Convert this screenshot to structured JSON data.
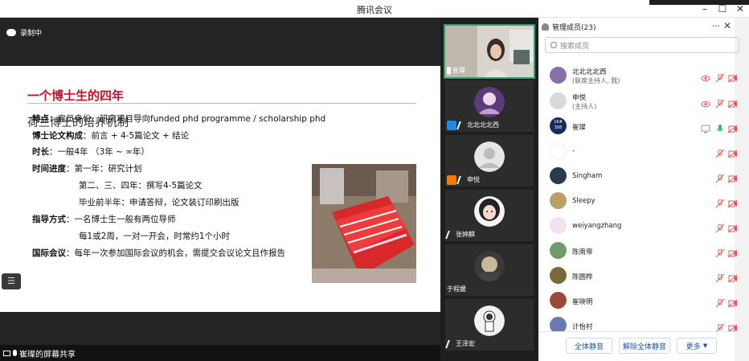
{
  "window": {
    "title": "腾讯会议"
  },
  "share": {
    "recording": "录制中",
    "footer": "崔璨的屏幕共享",
    "slide": {
      "title": "一个博士生的四年",
      "subtitle": "荷兰博士的培养机制",
      "lines": [
        {
          "label": "特点",
          "sep": "：",
          "text": "雇员身份、研究项目导向funded phd programme / scholarship phd"
        },
        {
          "label": "博士论文构成",
          "sep": "：",
          "text": "前言 + 4-5篇论文 + 结论"
        },
        {
          "label": "时长",
          "sep": "：",
          "text": "一般4年 （3年 ~ ∞年）"
        },
        {
          "label": "时间进度",
          "sep": "：",
          "text": "第一年：研究计划"
        },
        {
          "label": "",
          "sep": "",
          "text": "第二、三、四年：撰写4-5篇论文"
        },
        {
          "label": "",
          "sep": "",
          "text": "毕业前半年：申请答辩，论文装订印刷出版"
        },
        {
          "label": "指导方式",
          "sep": "：",
          "text": "一名博士生一般有两位导师"
        },
        {
          "label": "",
          "sep": "",
          "text": "每1或2周，一对一开会，时常约1个小时"
        },
        {
          "label": "国际会议",
          "sep": "：",
          "text": "每年一次参加国际会议的机会，需提交会议论文且作报告"
        }
      ]
    }
  },
  "tiles": [
    {
      "name": "崔璨",
      "active": true,
      "kind": "video"
    },
    {
      "name": "北北北北西",
      "kind": "avatar-pink",
      "badge": "blue"
    },
    {
      "name": "申悦",
      "kind": "avatar-gray",
      "badge": "orange"
    },
    {
      "name": "张婷麒",
      "kind": "avatar-girl"
    },
    {
      "name": "于程媛",
      "kind": "avatar-dark"
    },
    {
      "name": "王泽宏",
      "kind": "avatar-astro"
    }
  ],
  "panel": {
    "title": "管理成员(23)",
    "search_placeholder": "搜索成员",
    "members": [
      {
        "name": "北北北北西",
        "role": "(联席主持人, 我)",
        "av": "#8b6fa8"
      },
      {
        "name": "申悦",
        "role": "(主持人)",
        "av": "#d9d9d9"
      },
      {
        "name": "崔璨",
        "role": "",
        "av": "#1a2a5a",
        "avtext": "16# 308"
      },
      {
        "name": "-",
        "role": "",
        "av": "#ffffff"
      },
      {
        "name": "Singham",
        "role": "",
        "av": "#2b3a4a"
      },
      {
        "name": "Sleepy",
        "role": "",
        "av": "#b9a06a"
      },
      {
        "name": "weiyangzhang",
        "role": "",
        "av": "#f1e4ee"
      },
      {
        "name": "陈南帝",
        "role": "",
        "av": "#6f9a6a"
      },
      {
        "name": "陈圆桦",
        "role": "",
        "av": "#7a6a3a"
      },
      {
        "name": "崔晓明",
        "role": "",
        "av": "#9a4a3a"
      },
      {
        "name": "计怡村",
        "role": "",
        "av": "#6a7ab0"
      }
    ],
    "buttons": {
      "mute_all": "全体静音",
      "unmute_all": "解除全体静音",
      "more": "更多"
    }
  },
  "colors": {
    "accent_red": "#c8102e",
    "accent_blue": "#1f4fa8",
    "mic_red": "#e05555",
    "mic_green": "#2eb872"
  }
}
